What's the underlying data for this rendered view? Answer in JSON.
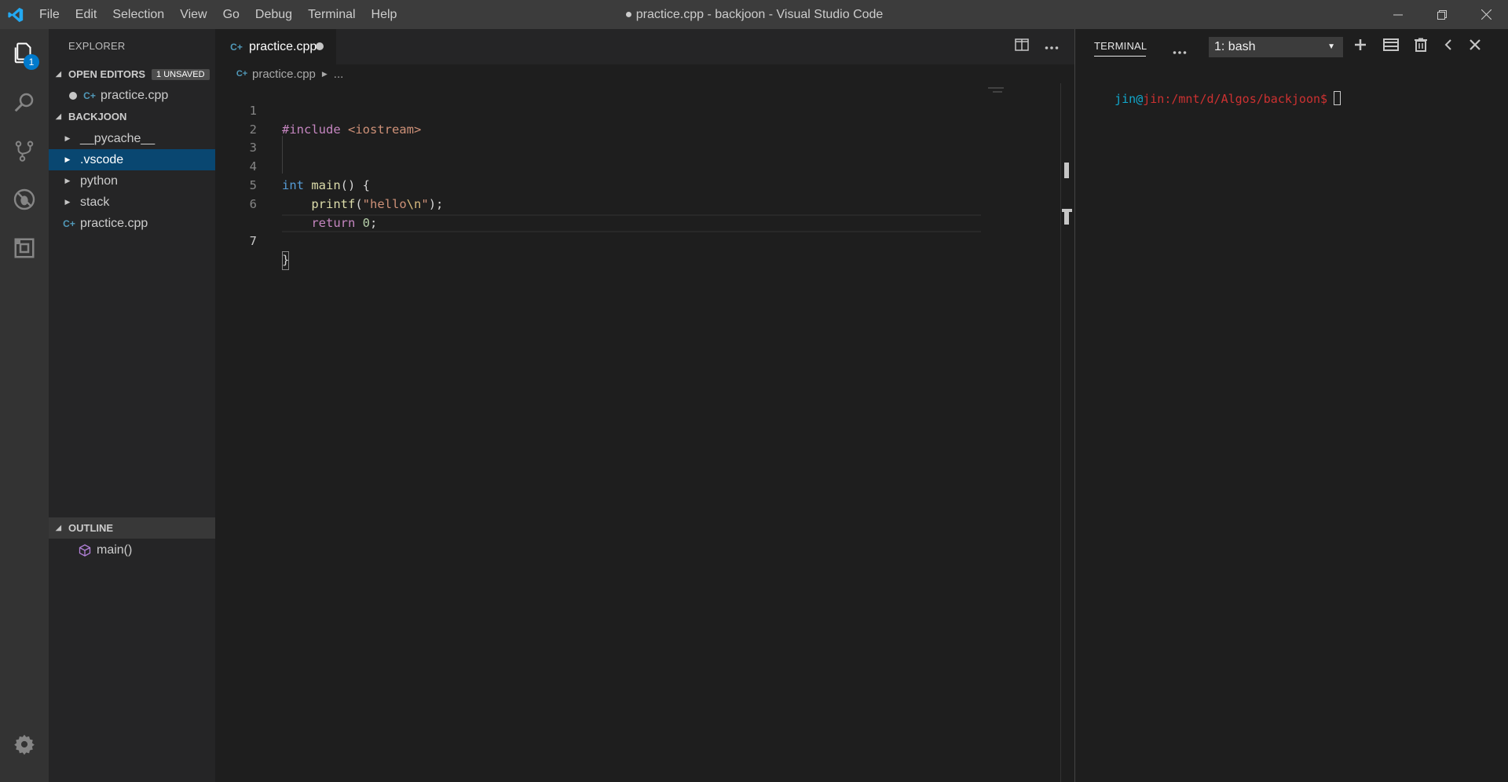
{
  "window": {
    "title": "● practice.cpp - backjoon - Visual Studio Code"
  },
  "menu": [
    "File",
    "Edit",
    "Selection",
    "View",
    "Go",
    "Debug",
    "Terminal",
    "Help"
  ],
  "activity": {
    "explorer_badge": "1"
  },
  "sidebar": {
    "title": "EXPLORER",
    "open_editors": {
      "label": "OPEN EDITORS",
      "badge": "1 UNSAVED",
      "files": [
        "practice.cpp"
      ]
    },
    "folder": {
      "label": "BACKJOON",
      "items": [
        {
          "label": "__pycache__",
          "type": "folder"
        },
        {
          "label": ".vscode",
          "type": "folder",
          "selected": true
        },
        {
          "label": "python",
          "type": "folder"
        },
        {
          "label": "stack",
          "type": "folder"
        },
        {
          "label": "practice.cpp",
          "type": "file"
        }
      ]
    },
    "outline": {
      "label": "OUTLINE",
      "items": [
        "main()"
      ]
    }
  },
  "editor": {
    "tab_label": "practice.cpp",
    "breadcrumb": {
      "file": "practice.cpp",
      "more": "..."
    },
    "line_numbers": [
      "1",
      "2",
      "3",
      "4",
      "5",
      "6",
      "7"
    ],
    "code": {
      "l1_pre": "#include",
      "l1_inc": " <iostream>",
      "l4_type": "int",
      "l4_fn": "main",
      "l4_rest": "() {",
      "l5_fn": "printf",
      "l5_open": "(",
      "l5_str_a": "\"hello",
      "l5_esc": "\\n",
      "l5_str_b": "\"",
      "l5_close": ");",
      "l6_kw": "return",
      "l6_num": "0",
      "l6_semi": ";",
      "l7": "}"
    }
  },
  "terminal": {
    "title": "TERMINAL",
    "selected_shell": "1: bash",
    "prompt_user": "jin",
    "prompt_at": "@",
    "prompt_host_path": "jin:/mnt/d/Algos/backjoon$"
  },
  "colors": {
    "accent": "#007acc",
    "selection": "#094771"
  }
}
